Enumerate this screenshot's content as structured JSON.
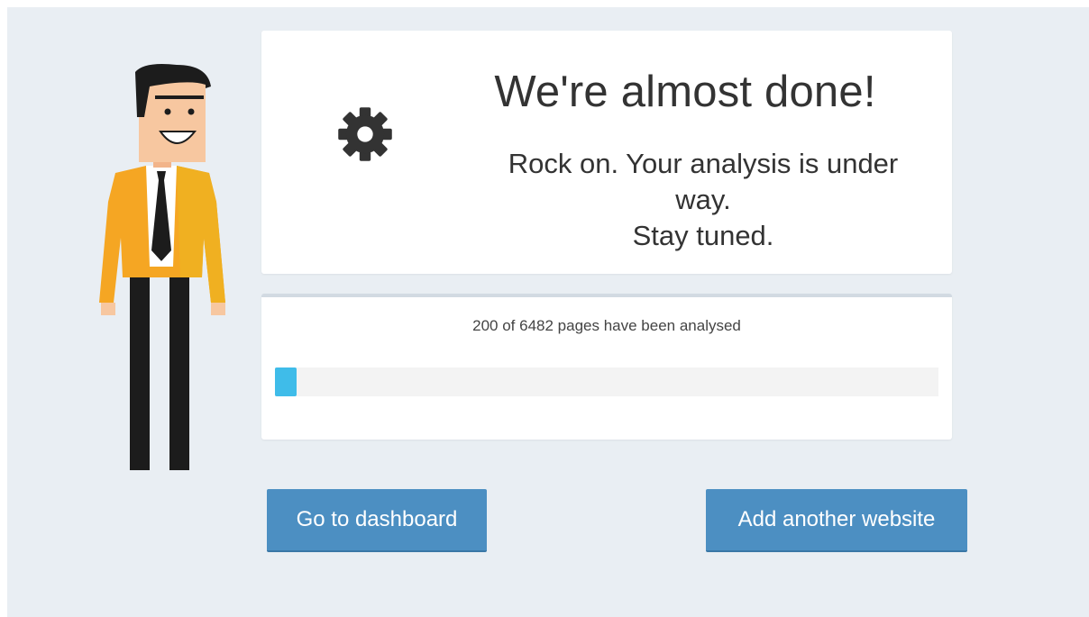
{
  "card": {
    "title": "We're almost done!",
    "subtitle_line1": "Rock on. Your analysis is under",
    "subtitle_line2": "way.",
    "subtitle_line3": "Stay tuned.",
    "icon": "gear-icon"
  },
  "progress": {
    "label": "200 of 6482 pages have been analysed",
    "done": 200,
    "total": 6482,
    "fill_color": "#3fbce9"
  },
  "buttons": {
    "dashboard_label": "Go to dashboard",
    "add_website_label": "Add another website"
  },
  "colors": {
    "background": "#e9eef3",
    "button": "#4c8fc2",
    "jacket": "#f5a623"
  }
}
